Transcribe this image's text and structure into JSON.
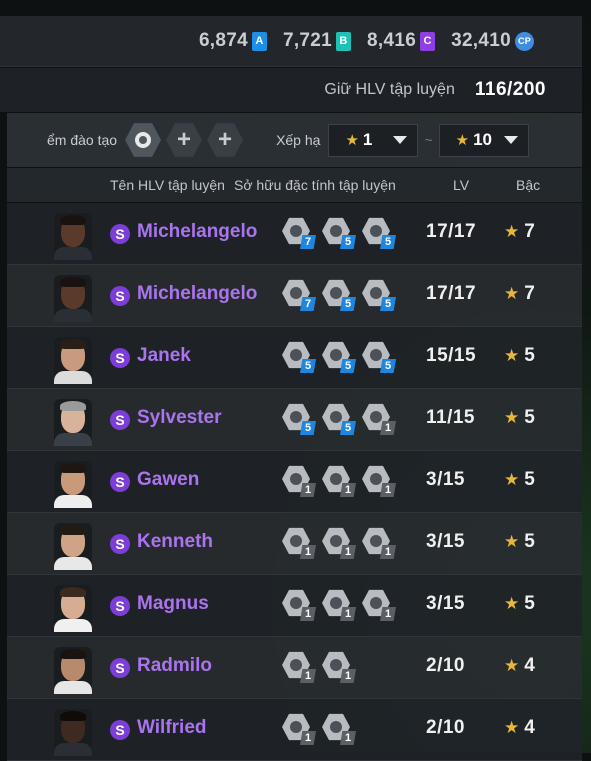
{
  "currencies": [
    {
      "value": "6,874",
      "badge": "A",
      "class": "a",
      "icon": "currency-a-icon"
    },
    {
      "value": "7,721",
      "badge": "B",
      "class": "b",
      "icon": "currency-b-icon"
    },
    {
      "value": "8,416",
      "badge": "C",
      "class": "c",
      "icon": "currency-c-icon"
    },
    {
      "value": "32,410",
      "badge": "CP",
      "class": "cp",
      "icon": "currency-cp-icon"
    }
  ],
  "hold": {
    "label": "Giữ HLV tập luyện",
    "value": "116/200"
  },
  "filter": {
    "training_label": "ểm đào tạo",
    "slot_plus": "+",
    "rank_label": "Xếp hạ",
    "rank_from": "1",
    "rank_to": "10",
    "tilde": "~",
    "star": "★"
  },
  "columns": {
    "name": "Tên HLV tập luyện",
    "traits": "Sở hữu đặc tính tập luyện",
    "level": "LV",
    "rank": "Bậc"
  },
  "coaches": [
    {
      "badge": "S",
      "name": "Michelangelo",
      "lv": "17/17",
      "rank": "7",
      "traits": [
        [
          "7",
          "blue"
        ],
        [
          "5",
          "blue"
        ],
        [
          "5",
          "blue"
        ]
      ],
      "skin": "#5a3a2a",
      "hair": "#1a1210",
      "shirt": "#2a2f35"
    },
    {
      "badge": "S",
      "name": "Michelangelo",
      "lv": "17/17",
      "rank": "7",
      "traits": [
        [
          "7",
          "blue"
        ],
        [
          "5",
          "blue"
        ],
        [
          "5",
          "blue"
        ]
      ],
      "skin": "#5a3a2a",
      "hair": "#1a1210",
      "shirt": "#2a2f35"
    },
    {
      "badge": "S",
      "name": "Janek",
      "lv": "15/15",
      "rank": "5",
      "traits": [
        [
          "5",
          "blue"
        ],
        [
          "5",
          "blue"
        ],
        [
          "5",
          "blue"
        ]
      ],
      "skin": "#c89a7e",
      "hair": "#2a1e18",
      "shirt": "#dcdcdc"
    },
    {
      "badge": "S",
      "name": "Sylvester",
      "lv": "11/15",
      "rank": "5",
      "traits": [
        [
          "5",
          "blue"
        ],
        [
          "5",
          "blue"
        ],
        [
          "1",
          "grey"
        ]
      ],
      "skin": "#d8b29a",
      "hair": "#9a9a9a",
      "shirt": "#3a4048"
    },
    {
      "badge": "S",
      "name": "Gawen",
      "lv": "3/15",
      "rank": "5",
      "traits": [
        [
          "1",
          "grey"
        ],
        [
          "1",
          "grey"
        ],
        [
          "1",
          "grey"
        ]
      ],
      "skin": "#c99a7a",
      "hair": "#1e1612",
      "shirt": "#eeeeee"
    },
    {
      "badge": "S",
      "name": "Kenneth",
      "lv": "3/15",
      "rank": "5",
      "traits": [
        [
          "1",
          "grey"
        ],
        [
          "1",
          "grey"
        ],
        [
          "1",
          "grey"
        ]
      ],
      "skin": "#cfa386",
      "hair": "#241a14",
      "shirt": "#e8e8e8"
    },
    {
      "badge": "S",
      "name": "Magnus",
      "lv": "3/15",
      "rank": "5",
      "traits": [
        [
          "1",
          "grey"
        ],
        [
          "1",
          "grey"
        ],
        [
          "1",
          "grey"
        ]
      ],
      "skin": "#d6ad92",
      "hair": "#3a2a20",
      "shirt": "#f0f0f0"
    },
    {
      "badge": "S",
      "name": "Radmilo",
      "lv": "2/10",
      "rank": "4",
      "traits": [
        [
          "1",
          "grey"
        ],
        [
          "1",
          "grey"
        ]
      ],
      "skin": "#b88a6c",
      "hair": "#1a1410",
      "shirt": "#e6e6e6"
    },
    {
      "badge": "S",
      "name": "Wilfried",
      "lv": "2/10",
      "rank": "4",
      "traits": [
        [
          "1",
          "grey"
        ],
        [
          "1",
          "grey"
        ]
      ],
      "skin": "#3e2a20",
      "hair": "#0f0b09",
      "shirt": "#2a2f35"
    }
  ]
}
